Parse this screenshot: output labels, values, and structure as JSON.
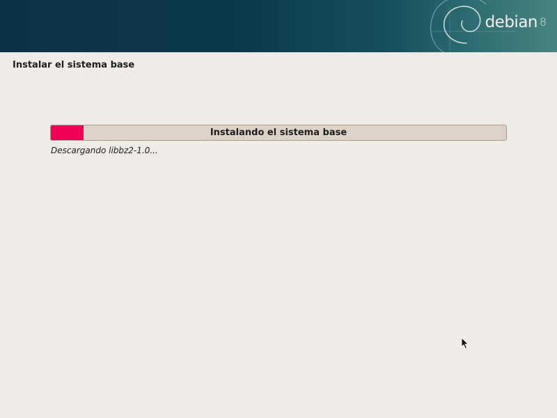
{
  "banner": {
    "logo_word": "debian",
    "logo_version": "8",
    "icon": "debian-swirl-icon"
  },
  "page": {
    "title": "Instalar el sistema base"
  },
  "progress": {
    "label": "Instalando el sistema base",
    "fraction": 0.07,
    "status": "Descargando libbz2-1.0..."
  },
  "colors": {
    "banner_dark": "#0a3444",
    "banner_light": "#4b8482",
    "background": "#efebe7",
    "progress_fill": "#ef0258",
    "progress_track": "#dcd2c8"
  },
  "cursor": {
    "icon": "mouse-pointer-icon"
  }
}
